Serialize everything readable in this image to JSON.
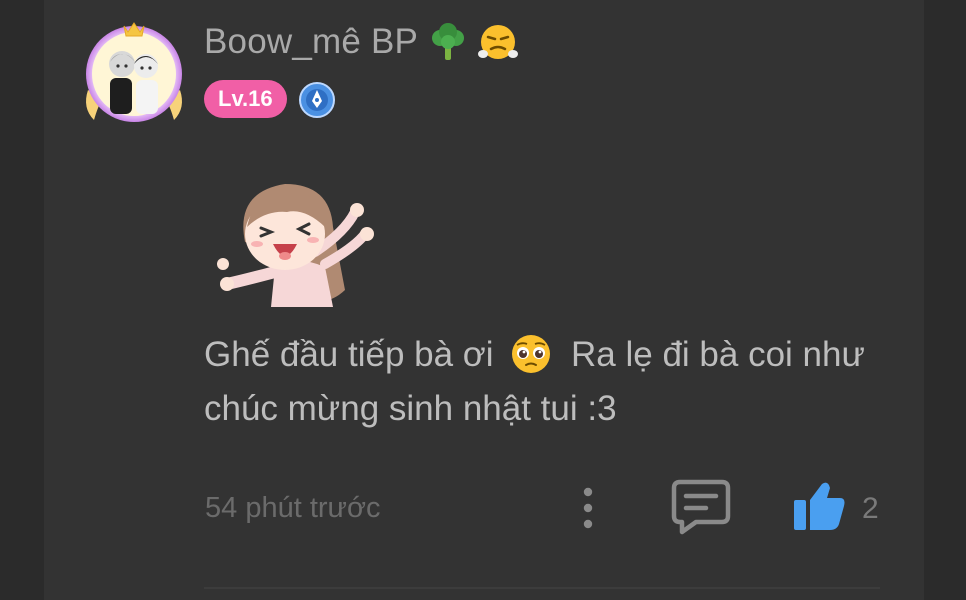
{
  "comment": {
    "username": "Boow_mê BP",
    "username_emojis": [
      "broccoli-emoji",
      "steam-from-nose-emoji"
    ],
    "level": "Lv.16",
    "text_part1": "Ghế đầu tiếp bà ơi",
    "text_part2": "Ra lẹ đi bà coi như chúc mừng sinh nhật tui :3",
    "inline_emoji": "pleading-face-emoji",
    "timestamp": "54 phút trước",
    "like_count": "2"
  },
  "colors": {
    "background": "#2b2b2b",
    "panel": "#333333",
    "level_badge": "#f15fa6",
    "like_blue": "#4a9ff0",
    "text": "#bdbdbd",
    "muted": "#6b6b6b"
  },
  "icons": {
    "more": "vertical-dots-icon",
    "reply": "comment-bubble-icon",
    "like": "thumbs-up-icon",
    "badge": "verified-pen-badge-icon"
  }
}
